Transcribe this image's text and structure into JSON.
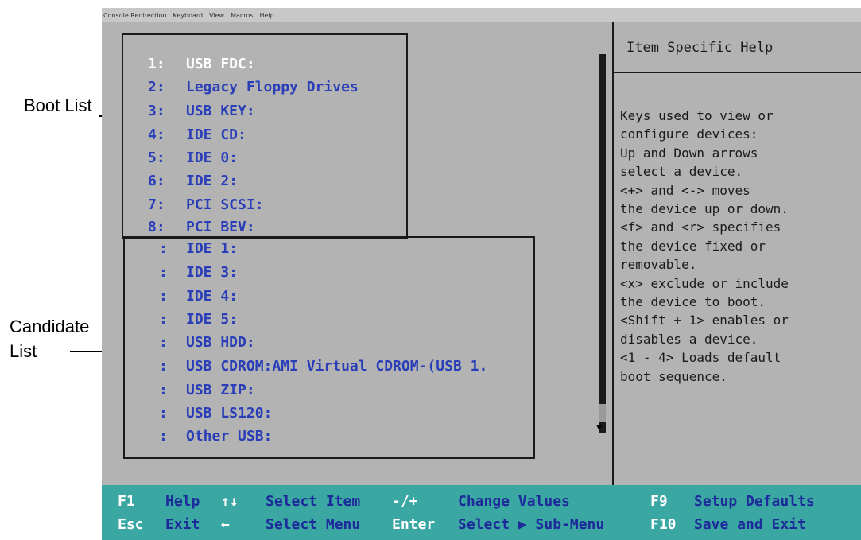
{
  "annotations": {
    "boot_list": "Boot List",
    "candidate_list_line1": "Candidate",
    "candidate_list_line2": "List"
  },
  "menubar": [
    "Console Redirection",
    "Keyboard",
    "View",
    "Macros",
    "Help"
  ],
  "boot_list": [
    {
      "num": "1:",
      "label": "USB FDC:"
    },
    {
      "num": "2:",
      "label": "Legacy Floppy Drives"
    },
    {
      "num": "3:",
      "label": "USB KEY:"
    },
    {
      "num": "4:",
      "label": "IDE CD:"
    },
    {
      "num": "5:",
      "label": "IDE 0:"
    },
    {
      "num": "6:",
      "label": "IDE 2:"
    },
    {
      "num": "7:",
      "label": "PCI SCSI:"
    },
    {
      "num": "8:",
      "label": "PCI BEV:"
    }
  ],
  "candidate_list": [
    {
      "num": ":",
      "label": "IDE 1:"
    },
    {
      "num": ":",
      "label": "IDE 3:"
    },
    {
      "num": ":",
      "label": "IDE 4:"
    },
    {
      "num": ":",
      "label": "IDE 5:"
    },
    {
      "num": ":",
      "label": "USB HDD:"
    },
    {
      "num": ":",
      "label": "USB CDROM:AMI Virtual CDROM-(USB 1."
    },
    {
      "num": ":",
      "label": "USB ZIP:"
    },
    {
      "num": ":",
      "label": "USB LS120:"
    },
    {
      "num": ":",
      "label": "Other USB:"
    }
  ],
  "help": {
    "title": "Item Specific Help",
    "lines": [
      "Keys used to view or",
      "configure devices:",
      "Up and Down arrows",
      "select a device.",
      "<+> and <-> moves",
      "the device up or down.",
      "<f> and <r> specifies",
      "the device fixed or",
      "removable.",
      "<x> exclude or include",
      "the device to boot.",
      "<Shift + 1> enables or",
      "disables a device.",
      "<1 - 4> Loads default",
      "boot sequence."
    ]
  },
  "scrollbar": {
    "down_arrow": "▼"
  },
  "footer": {
    "row1": [
      {
        "key": "F1",
        "desc": "Help"
      },
      {
        "key": "↑↓",
        "desc": "Select Item"
      },
      {
        "key": "-/+",
        "desc": "Change Values"
      },
      {
        "key": "F9",
        "desc": "Setup Defaults"
      }
    ],
    "row2": [
      {
        "key": "Esc",
        "desc": "Exit"
      },
      {
        "key": "←",
        "desc": "Select Menu"
      },
      {
        "key": "Enter",
        "desc": "Select ▶ Sub-Menu"
      },
      {
        "key": "F10",
        "desc": "Save and Exit"
      }
    ]
  },
  "colors": {
    "item": "#2a3eb8",
    "selected": "#ffffff",
    "footer_bg": "#3aa7a3",
    "bios_bg": "#b3b3b3"
  }
}
